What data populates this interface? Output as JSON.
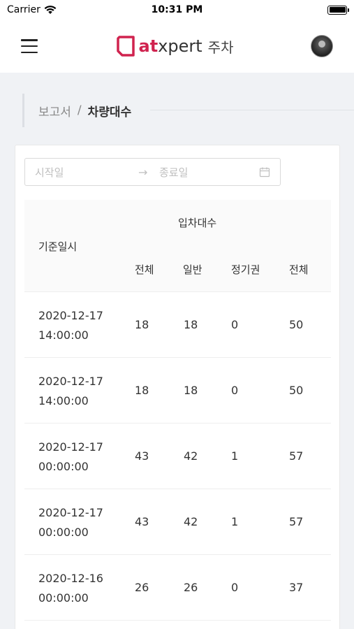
{
  "status_bar": {
    "carrier": "Carrier",
    "time": "10:31 PM"
  },
  "header": {
    "brand_at": "at",
    "brand_rest": "xpert",
    "brand_sub": "주차",
    "brand_color": "#d0234f"
  },
  "breadcrumb": {
    "parent": "보고서",
    "separator": "/",
    "current": "차량대수"
  },
  "date_range": {
    "start_placeholder": "시작일",
    "arrow": "→",
    "end_placeholder": "종료일"
  },
  "table": {
    "base_col": "기준일시",
    "group_col": "입차대수",
    "sub_cols": [
      "전체",
      "일반",
      "정기권"
    ],
    "last_col": "전체",
    "rows": [
      {
        "date": "2020-12-17",
        "time": "14:00:00",
        "total": "18",
        "general": "18",
        "season": "0",
        "all": "50"
      },
      {
        "date": "2020-12-17",
        "time": "14:00:00",
        "total": "18",
        "general": "18",
        "season": "0",
        "all": "50"
      },
      {
        "date": "2020-12-17",
        "time": "00:00:00",
        "total": "43",
        "general": "42",
        "season": "1",
        "all": "57"
      },
      {
        "date": "2020-12-17",
        "time": "00:00:00",
        "total": "43",
        "general": "42",
        "season": "1",
        "all": "57"
      },
      {
        "date": "2020-12-16",
        "time": "00:00:00",
        "total": "26",
        "general": "26",
        "season": "0",
        "all": "37"
      }
    ]
  }
}
